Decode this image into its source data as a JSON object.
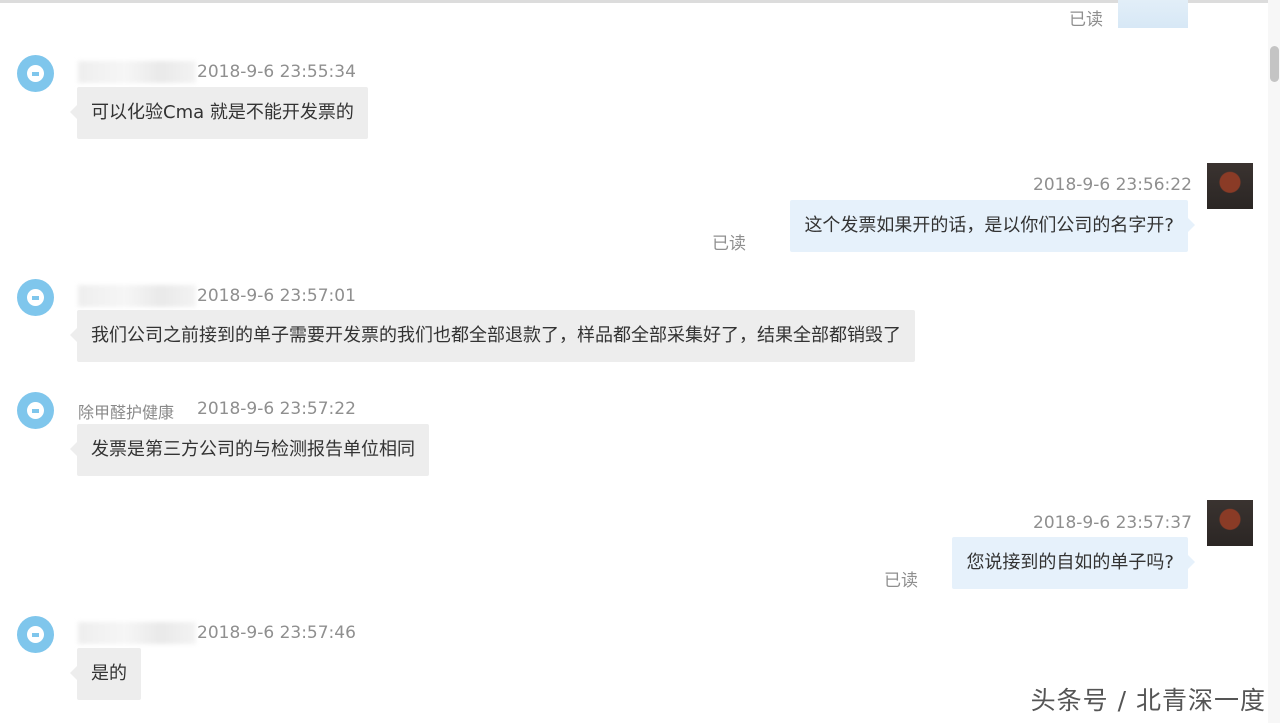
{
  "read_label": "已读",
  "messages": [
    {
      "time": "2018-9-6 23:55:34",
      "text": "可以化验Cma 就是不能开发票的"
    },
    {
      "time": "2018-9-6 23:56:22",
      "text": "这个发票如果开的话，是以你们公司的名字开?"
    },
    {
      "time": "2018-9-6 23:57:01",
      "text": "我们公司之前接到的单子需要开发票的我们也都全部退款了，样品都全部采集好了，结果全部都销毁了"
    },
    {
      "sender": "除甲醛护健康",
      "time": "2018-9-6 23:57:22",
      "text": "发票是第三方公司的与检测报告单位相同"
    },
    {
      "time": "2018-9-6 23:57:37",
      "text": "您说接到的自如的单子吗?"
    },
    {
      "time": "2018-9-6 23:57:46",
      "text": "是的"
    }
  ],
  "watermark": "头条号 / 北青深一度"
}
